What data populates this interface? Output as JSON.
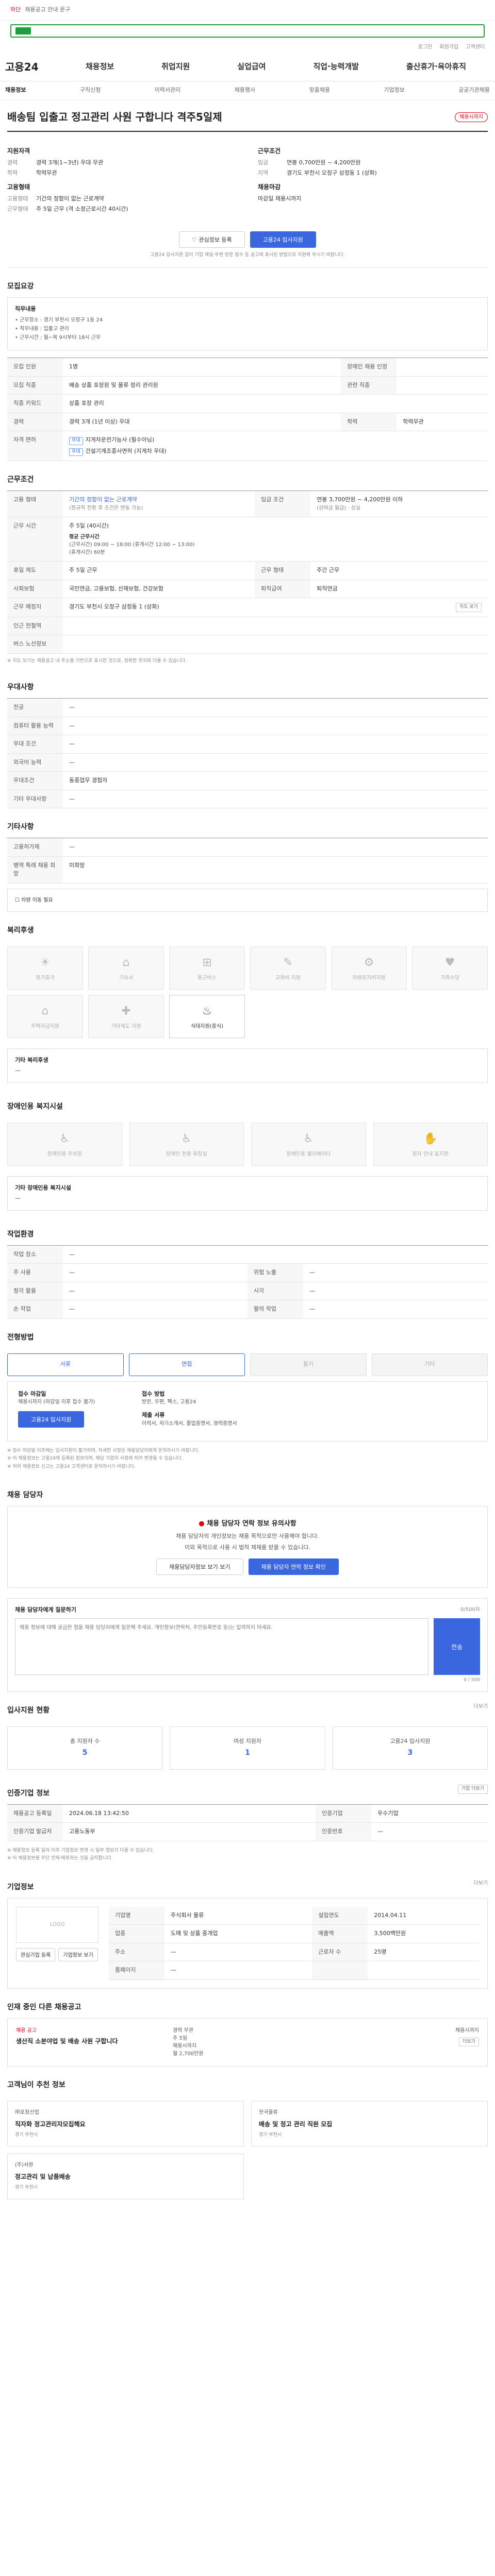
{
  "top": {
    "tag": "하단",
    "notice": "채용공고 안내 문구"
  },
  "search": {
    "placeholder": ""
  },
  "util": [
    "로그인",
    "회원가입",
    "고객센터"
  ],
  "gnb": {
    "brand": "고용24",
    "menu": [
      "채용정보",
      "취업지원",
      "실업급여",
      "직업·능력개발",
      "출산휴가·육아휴직"
    ]
  },
  "subnav": [
    "채용정보",
    "구직신청",
    "이력서관리",
    "채용행사",
    "맞춤채용",
    "기업정보",
    "공공기관채용"
  ],
  "job": {
    "title": "배송팀 입출고 정고관리 사원 구합니다 격주5일제",
    "status": "채용시까지",
    "company_title": "지원자격",
    "company_items": [
      {
        "k": "경력",
        "v": "경력 3개(1~3년) 우대 무관"
      },
      {
        "k": "학력",
        "v": "학력무관"
      }
    ],
    "cond_title": "근무조건",
    "cond_items": [
      {
        "k": "임금",
        "v": "연봉 0,700만원 ~ 4,200만원"
      },
      {
        "k": "지역",
        "v": "경기도 부천시 오정구 삼정동 1 (상화)"
      }
    ],
    "emp_title": "고용형태",
    "emp_items": [
      {
        "k": "고용형태",
        "v": "기간의 정함이 없는 근로계약"
      },
      {
        "k": "근무형태",
        "v": "주 5일 근무 (격 소정근로시간 40시간)"
      }
    ],
    "deadline_title": "채용마감",
    "deadline_value": "마감일 채용시까지",
    "btn_interest": "관심정보 등록",
    "btn_apply": "고용24 입사지원",
    "notice": "고용24 입사지원 없이 기업 메일·우편 방문 접수 등 공고에 표시된 방법으로 지원해 주시기 바랍니다."
  },
  "duty": {
    "section": "모집요강",
    "box_title": "직무내용",
    "box_items": [
      "• 근무장소 : 경기 부천시 오정구 1동 24",
      "• 직무내용 : 입출고 관리",
      "• 근무시간 : 월~목 9시부터 18시 근무"
    ],
    "rows": [
      {
        "h": "모집 인원",
        "v": "1명",
        "h2": "장애인 채용 인정",
        "v2": ""
      },
      {
        "h": "모집 직종",
        "v": "배송 상품 포장원 및 물류 정리 관리원",
        "h2": "관련 직종",
        "v2": ""
      },
      {
        "h": "직종 키워드",
        "v": "상품 포장 관리",
        "h2": "",
        "v2": ""
      },
      {
        "h": "경력",
        "v": "경력 3개 (1년 이상) 우대",
        "h2": "학력",
        "v2": "학력무관"
      },
      {
        "h": "자격 면허",
        "c1": "우대",
        "t1": "지게차운전기능사 (필수아님)",
        "c2": "우대",
        "t2": "건설기계조종사면허 (지게차 우대)"
      }
    ]
  },
  "work": {
    "section": "근무조건",
    "rows": [
      {
        "h": "고용 형태",
        "v": "기간의 정함이 없는 근로계약",
        "v_b": "(정규직 전환 후 조건은 변동 가능)",
        "h2": "임금 조건",
        "v2": "연봉 3,700만원 ~ 4,200만원 이하",
        "v2_b": "(상여금 월급) · 성실"
      },
      {
        "h": "근무 시간",
        "v": "주 5일 (40시간)",
        "sub1": "평균 근무시간",
        "v3": "(근무시간) 09:00 ~ 18:00 (휴게시간 12:00 ~ 13:00)",
        "v4": "(휴게시간) 60분"
      },
      {
        "h": "휴일 제도",
        "v": "주 5일 근무",
        "h2": "근무 형태",
        "v2": "주간 근무"
      },
      {
        "h": "사회보험",
        "v": "국민연금, 고용보험, 산재보험, 건강보험",
        "h2": "퇴직급여",
        "v2": "퇴직연금"
      },
      {
        "h": "근무 예정지",
        "v": "경기도 부천시 오정구 삼정동 1 (상화)",
        "btn": "지도 보기"
      },
      {
        "h": "인근 전철역",
        "v": ""
      },
      {
        "h": "버스 노선정보",
        "v": ""
      }
    ],
    "note": "※ 지도 보기는 채용공고 내 주소를 기반으로 표시한 것으로, 정확한 위치와 다를 수 있습니다."
  },
  "pref": {
    "section": "우대사항",
    "rows": [
      {
        "h": "전공",
        "v": "—"
      },
      {
        "h": "컴퓨터 활용 능력",
        "v": "—"
      },
      {
        "h": "우대 조건",
        "v": "—"
      },
      {
        "h": "외국어 능력",
        "v": "—"
      },
      {
        "h": "우대조건",
        "v": "동종업무 경험자"
      },
      {
        "h": "기타 우대사항",
        "v": "—"
      }
    ]
  },
  "etc": {
    "section": "기타사항",
    "rows": [
      {
        "h": "고용허가제",
        "v": "—"
      },
      {
        "h": "병역 특례 채용 희망",
        "v": "미희망"
      }
    ],
    "check": "차량 이동 필요"
  },
  "welfare": {
    "section": "복리후생",
    "items": [
      {
        "t": "정기휴가",
        "on": false,
        "i": "☀"
      },
      {
        "t": "기숙사",
        "on": false,
        "i": "⌂"
      },
      {
        "t": "통근버스",
        "on": false,
        "i": "⊞"
      },
      {
        "t": "교육비 지원",
        "on": false,
        "i": "✎"
      },
      {
        "t": "차량유지비지원",
        "on": false,
        "i": "⚙"
      },
      {
        "t": "가족수당",
        "on": false,
        "i": "♥"
      },
      {
        "t": "주택자금지원",
        "on": false,
        "i": "⌂"
      },
      {
        "t": "기타제도 지원",
        "on": false,
        "i": "✚"
      },
      {
        "t": "식대지원(중식)",
        "on": true,
        "i": "♨"
      }
    ],
    "list_title": "기타 복리후생",
    "list_value": "—"
  },
  "disabled": {
    "section": "장애인용 복지시설",
    "items": [
      {
        "t": "장애인용 주차장",
        "i": "♿"
      },
      {
        "t": "장애인 전용 화장실",
        "i": "♿"
      },
      {
        "t": "장애인용 엘리베이터",
        "i": "♿"
      },
      {
        "t": "점자 안내 표지판",
        "i": "✋"
      }
    ],
    "list_title": "기타 장애인용 복지시설",
    "list_value": "—"
  },
  "env": {
    "section": "작업환경",
    "rows": [
      {
        "h": "작업 장소",
        "v": "—",
        "h2": "",
        "v2": ""
      },
      {
        "h": "주 사용",
        "v": "—",
        "h2": "위험 노출",
        "v2": "—"
      },
      {
        "h": "청각 활용",
        "v": "—",
        "h2": "시각",
        "v2": "—"
      },
      {
        "h": "손 작업",
        "v": "—",
        "h2": "팔의 작업",
        "v2": "—"
      }
    ]
  },
  "proc": {
    "section": "전형방법",
    "steps": [
      {
        "t": "서류",
        "s": "on"
      },
      {
        "t": "면접",
        "s": "on"
      },
      {
        "t": "필기",
        "s": "off"
      },
      {
        "t": "기타",
        "s": "off"
      }
    ],
    "apply_label": "접수 마감일",
    "apply_value": "채용시까지 (마감일 이후 접수 불가)",
    "apply_btn": "고용24 입사지원",
    "method_label": "접수 방법",
    "method_value": "방문, 우편, 팩스, 고용24",
    "docs_label": "제출 서류",
    "docs_value": "이력서, 자기소개서, 졸업증명서, 경력증명서",
    "bullets": [
      "※ 접수 마감일 이후에는 입사지원이 불가하며, 자세한 사항은 채용담당자에게 문의하시기 바랍니다.",
      "※ 이 채용정보는 고용24에 등록된 정보이며, 해당 기업의 사정에 따라 변경될 수 있습니다.",
      "※ 허위 채용정보 신고는 고용24 고객센터로 문의하시기 바랍니다."
    ]
  },
  "contact": {
    "section": "채용 담당자",
    "warn": "채용 담당자 연락 정보 유의사항",
    "p1": "채용 담당자의 개인정보는 채용 목적으로만 사용해야 합니다.",
    "p2": "이외 목적으로 사용 시 법적 제재를 받을 수 있습니다.",
    "btn1": "채용담당자정보 보기 보기",
    "btn2": "채용 담당자 연락 정보 확인"
  },
  "qna": {
    "section": "채용 담당자에게 질문하기",
    "limit": "0/500자",
    "placeholder": "채용 정보에 대해 궁금한 점을 채용 담당자에게 질문해 주세요. 개인정보(연락처, 주민등록번호 등)는 입력하지 마세요.",
    "send": "전송",
    "foot": "0 / 500"
  },
  "applicants": {
    "section": "입사지원 현황",
    "more": "더보기",
    "stats": [
      {
        "lab": "총 지원자 수",
        "num": "5"
      },
      {
        "lab": "여성 지원자",
        "num": "1"
      },
      {
        "lab": "고용24 입사지원",
        "num": "3"
      }
    ]
  },
  "info": {
    "section": "인증기업 정보",
    "btn": "기업 더보기",
    "rows": [
      {
        "h": "채용공고 등록일",
        "v": "2024.06.18 13:42:50",
        "h2": "인증기업",
        "v2": "우수기업"
      },
      {
        "h": "인증기업 발급처",
        "v": "고용노동부",
        "h2": "인증번호",
        "v2": "—"
      }
    ],
    "notes": [
      "※ 채용정보 등록 일자 이후 기업정보 변경 시 일부 정보가 다를 수 있습니다.",
      "※ 이 채용정보를 무단 전재·배포하는 것을 금지합니다."
    ]
  },
  "company": {
    "section": "기업정보",
    "more": "더보기",
    "logo": "LOGO",
    "rows": [
      {
        "k": "기업명",
        "v": "주식회사 물류",
        "k2": "설립연도",
        "v2": "2014.04.11"
      },
      {
        "k": "업종",
        "v": "도매 및 상품 중개업",
        "k2": "매출액",
        "v2": "3,500백만원"
      },
      {
        "k": "주소",
        "v": "—",
        "k2": "근로자 수",
        "v2": "25명"
      },
      {
        "k": "홈페이지",
        "v": "—",
        "k2": "",
        "v2": ""
      }
    ],
    "btn1": "관심기업 등록",
    "btn2": "기업정보 보기"
  },
  "other": {
    "section": "인재 중인 다른 채용공고",
    "col1_tag": "채용 공고",
    "col1_title": "생산직 소분야업 및 배송 사원 구합니다",
    "col2": [
      "경력 무관",
      "주 5일",
      "채용시까지",
      "월 2,700만원"
    ],
    "col3": [
      "채용시까지",
      "더보기"
    ]
  },
  "recommend": {
    "section": "고객님이 추천 정보",
    "items": [
      {
        "co": "㈜포장산업",
        "t": "직자화 정고관리자모집해요",
        "m": "경기 부천시"
      },
      {
        "co": "한국물류",
        "t": "배송 및 정고 관리 직원 모집",
        "m": "경기 부천시"
      },
      {
        "co": "(주)서원",
        "t": "정고관리 및 납품배송",
        "m": "경기 부천시"
      }
    ]
  }
}
